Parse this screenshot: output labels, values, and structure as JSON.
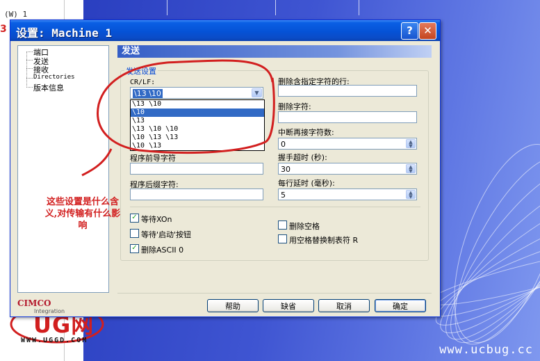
{
  "desktop": {
    "left_text": "(W) 1",
    "red_mark": "3",
    "watermark": "www.ucbug.cc",
    "ug_logo": {
      "text": "UG网",
      "url": "WWW.UGGD.COM",
      "side": "UG"
    },
    "annotation": "这些设置是什么含义,对传输有什么影响"
  },
  "dialog": {
    "title": "设置: Machine 1",
    "help_label": "?",
    "close_label": "✕",
    "tree": {
      "items": [
        {
          "label": "端口"
        },
        {
          "label": "发送"
        },
        {
          "label": "接收"
        },
        {
          "label": "Directories"
        },
        {
          "label": "版本信息"
        }
      ]
    },
    "logo": {
      "name": "CIMCO",
      "sub": "Integration"
    },
    "panel_title": "发送",
    "group_title": "发送设置",
    "crlf": {
      "label": "CR/LF:",
      "value": "\\13 \\10",
      "options": [
        "\\13 \\10",
        "\\10",
        "\\13",
        "\\13 \\10 \\10",
        "\\10 \\13 \\13",
        "\\10 \\13"
      ],
      "highlighted_index": 1
    },
    "prefix": {
      "label": "程序前导字符",
      "value": ""
    },
    "suffix": {
      "label": "程序后缀字符:",
      "value": ""
    },
    "delete_lines": {
      "label": "删除含指定字符的行:",
      "value": ""
    },
    "delete_chars": {
      "label": "删除字符:",
      "value": ""
    },
    "resume_chars": {
      "label": "中断再接字符数:",
      "value": "0"
    },
    "handshake_timeout": {
      "label": "握手超时 (秒):",
      "value": "30"
    },
    "line_delay": {
      "label": "每行延时 (毫秒):",
      "value": "5"
    },
    "wait_xon": {
      "label": "等待XOn",
      "checked": true
    },
    "wait_start": {
      "label": "等待'启动'按钮",
      "checked": false
    },
    "delete_ascii": {
      "label": "删除ASCII 0",
      "checked": true
    },
    "delete_spaces": {
      "label": "删除空格",
      "checked": false
    },
    "tab_replace": {
      "label": "用空格替换制表符 R",
      "checked": false
    },
    "buttons": {
      "help": "帮助",
      "default": "缺省",
      "cancel": "取消",
      "ok": "确定"
    },
    "colors": {
      "title_bar": "#0552d6",
      "panel_header": "#355ec6",
      "selection": "#316ac5"
    }
  }
}
